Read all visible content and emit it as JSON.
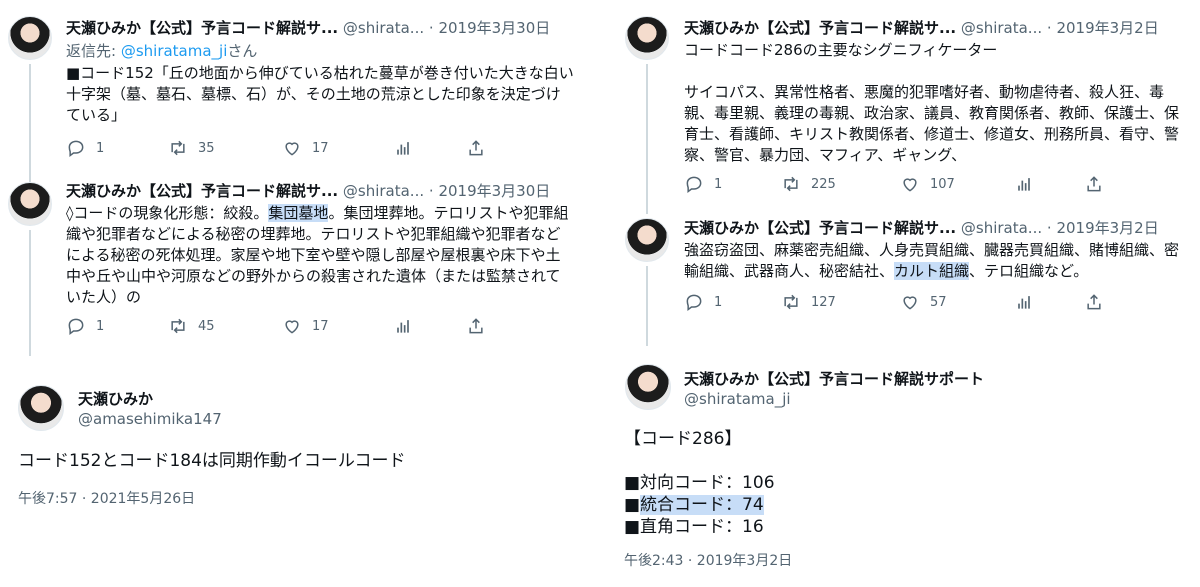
{
  "left": {
    "tweet1": {
      "name": "天瀬ひみか【公式】予言コード解説サ...",
      "handle": "@shirata...",
      "sep": " · ",
      "date": "2019年3月30日",
      "reply_prefix": "返信先: ",
      "reply_link": "@shiratama_ji",
      "reply_suffix": "さん",
      "text": "■コード152「丘の地面から伸びている枯れた蔓草が巻き付いた大きな白い\n十字架（墓、墓石、墓標、石）が、その土地の荒涼とした印象を決定づけ\nている」",
      "replies": "1",
      "retweets": "35",
      "likes": "17"
    },
    "tweet2": {
      "name": "天瀬ひみか【公式】予言コード解説サ...",
      "handle": "@shirata...",
      "sep": " · ",
      "date": "2019年3月30日",
      "text_before": "◊コードの現象化形態：絞殺。",
      "text_hl": "集団墓地",
      "text_after": "。集団埋葬地。テロリストや犯罪組\n織や犯罪者などによる秘密の埋葬地。テロリストや犯罪組織や犯罪者など\nによる秘密の死体処理。家屋や地下室や壁や隠し部屋や屋根裏や床下や土\n中や丘や山中や河原などの野外からの殺害された遺体（または監禁されて\nいた人）の",
      "replies": "1",
      "retweets": "45",
      "likes": "17"
    },
    "main": {
      "name": "天瀬ひみか",
      "handle": "@amasehimika147",
      "text": "コード152とコード184は同期作動イコールコード",
      "time": "午後7:57 · 2021年5月26日"
    }
  },
  "right": {
    "tweet1": {
      "name": "天瀬ひみか【公式】予言コード解説サ...",
      "handle": "@shirata...",
      "sep": " · ",
      "date": "2019年3月2日",
      "text": "コードコード286の主要なシグニフィケーター\n\nサイコパス、異常性格者、悪魔的犯罪嗜好者、動物虐待者、殺人狂、毒\n親、毒里親、義理の毒親、政治家、議員、教育関係者、教師、保護士、保\n育士、看護師、キリスト教関係者、修道士、修道女、刑務所員、看守、警\n察、警官、暴力団、マフィア、ギャング、",
      "replies": "1",
      "retweets": "225",
      "likes": "107"
    },
    "tweet2": {
      "name": "天瀬ひみか【公式】予言コード解説サ...",
      "handle": "@shirata...",
      "sep": " · ",
      "date": "2019年3月2日",
      "text_before": "強盗窃盗団、麻薬密売組織、人身売買組織、臓器売買組織、賭博組織、密\n輸組織、武器商人、秘密結社、",
      "text_hl": "カルト組織",
      "text_after": "、テロ組織など。",
      "replies": "1",
      "retweets": "127",
      "likes": "57"
    },
    "main": {
      "name": "天瀬ひみか【公式】予言コード解説サポート",
      "handle": "@shiratama_ji",
      "line1": "【コード286】",
      "line2": "■対向コード：106",
      "line3_marker": "■",
      "line3_hl": "統合コード：74",
      "line4": "■直角コード：16",
      "time": "午後2:43 · 2019年3月2日"
    }
  },
  "icons": [
    "reply-icon",
    "retweet-icon",
    "like-icon",
    "analytics-icon",
    "share-icon"
  ],
  "colors": {
    "link": "#1d9bf0",
    "muted": "#536471",
    "highlight": "#c7ddf7",
    "thread": "#cfd9de"
  }
}
